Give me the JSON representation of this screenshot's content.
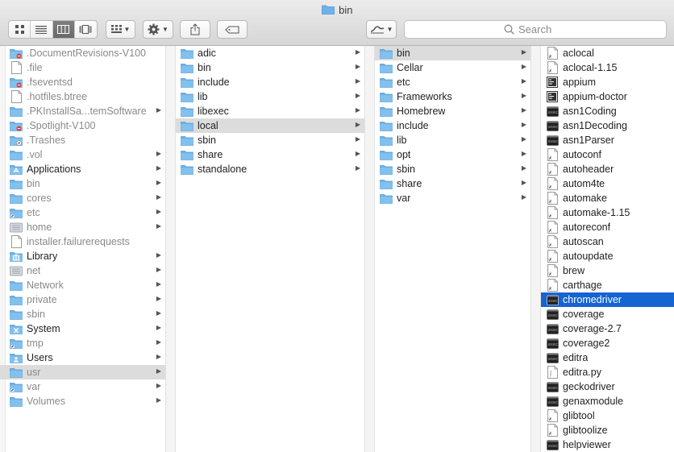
{
  "window": {
    "title": "bin"
  },
  "toolbar": {
    "view_modes": [
      "icon-view",
      "list-view",
      "column-view",
      "cover-flow-view"
    ],
    "active_view": "column-view",
    "search_placeholder": "Search"
  },
  "columns": [
    {
      "items": [
        {
          "label": ".DocumentRevisions-V100",
          "icon": "restricted-folder-icon",
          "dim": true,
          "arrow": false
        },
        {
          "label": ".file",
          "icon": "file-icon",
          "dim": true,
          "arrow": false
        },
        {
          "label": ".fseventsd",
          "icon": "restricted-folder-icon",
          "dim": true,
          "arrow": false
        },
        {
          "label": ".hotfiles.btree",
          "icon": "file-icon",
          "dim": true,
          "arrow": false
        },
        {
          "label": ".PKInstallSa...temSoftware",
          "icon": "folder-icon",
          "dim": true,
          "arrow": true
        },
        {
          "label": ".Spotlight-V100",
          "icon": "restricted-folder-icon",
          "dim": true,
          "arrow": false
        },
        {
          "label": ".Trashes",
          "icon": "trash-folder-icon",
          "dim": true,
          "arrow": false
        },
        {
          "label": ".vol",
          "icon": "folder-icon",
          "dim": true,
          "arrow": true
        },
        {
          "label": "Applications",
          "icon": "applications-folder-icon",
          "dim": false,
          "arrow": true
        },
        {
          "label": "bin",
          "icon": "folder-icon",
          "dim": true,
          "arrow": true
        },
        {
          "label": "cores",
          "icon": "folder-icon",
          "dim": true,
          "arrow": true
        },
        {
          "label": "etc",
          "icon": "alias-folder-icon",
          "dim": true,
          "arrow": true
        },
        {
          "label": "home",
          "icon": "network-folder-icon",
          "dim": true,
          "arrow": true
        },
        {
          "label": "installer.failurerequests",
          "icon": "file-icon",
          "dim": true,
          "arrow": false
        },
        {
          "label": "Library",
          "icon": "library-folder-icon",
          "dim": false,
          "arrow": true
        },
        {
          "label": "net",
          "icon": "network-folder-icon",
          "dim": true,
          "arrow": true
        },
        {
          "label": "Network",
          "icon": "folder-icon",
          "dim": true,
          "arrow": true
        },
        {
          "label": "private",
          "icon": "folder-icon",
          "dim": true,
          "arrow": true
        },
        {
          "label": "sbin",
          "icon": "folder-icon",
          "dim": true,
          "arrow": true
        },
        {
          "label": "System",
          "icon": "system-folder-icon",
          "dim": false,
          "arrow": true
        },
        {
          "label": "tmp",
          "icon": "alias-folder-icon",
          "dim": true,
          "arrow": true
        },
        {
          "label": "Users",
          "icon": "users-folder-icon",
          "dim": false,
          "arrow": true
        },
        {
          "label": "usr",
          "icon": "folder-icon",
          "dim": true,
          "arrow": true,
          "selected": "gray"
        },
        {
          "label": "var",
          "icon": "alias-folder-icon",
          "dim": true,
          "arrow": true
        },
        {
          "label": "Volumes",
          "icon": "folder-icon",
          "dim": true,
          "arrow": true
        }
      ]
    },
    {
      "items": [
        {
          "label": "adic",
          "icon": "folder-icon",
          "arrow": true
        },
        {
          "label": "bin",
          "icon": "folder-icon",
          "arrow": true
        },
        {
          "label": "include",
          "icon": "folder-icon",
          "arrow": true
        },
        {
          "label": "lib",
          "icon": "folder-icon",
          "arrow": true
        },
        {
          "label": "libexec",
          "icon": "folder-icon",
          "arrow": true
        },
        {
          "label": "local",
          "icon": "folder-icon",
          "arrow": true,
          "selected": "gray"
        },
        {
          "label": "sbin",
          "icon": "folder-icon",
          "arrow": true
        },
        {
          "label": "share",
          "icon": "folder-icon",
          "arrow": true
        },
        {
          "label": "standalone",
          "icon": "folder-icon",
          "arrow": true
        }
      ]
    },
    {
      "items": [
        {
          "label": "bin",
          "icon": "folder-icon",
          "arrow": true,
          "selected": "gray"
        },
        {
          "label": "Cellar",
          "icon": "folder-icon",
          "arrow": true
        },
        {
          "label": "etc",
          "icon": "folder-icon",
          "arrow": true
        },
        {
          "label": "Frameworks",
          "icon": "folder-icon",
          "arrow": true
        },
        {
          "label": "Homebrew",
          "icon": "folder-icon",
          "arrow": true
        },
        {
          "label": "include",
          "icon": "folder-icon",
          "arrow": true
        },
        {
          "label": "lib",
          "icon": "folder-icon",
          "arrow": true
        },
        {
          "label": "opt",
          "icon": "folder-icon",
          "arrow": true
        },
        {
          "label": "sbin",
          "icon": "folder-icon",
          "arrow": true
        },
        {
          "label": "share",
          "icon": "folder-icon",
          "arrow": true
        },
        {
          "label": "var",
          "icon": "folder-icon",
          "arrow": true
        }
      ]
    },
    {
      "items": [
        {
          "label": "aclocal",
          "icon": "script-file-icon"
        },
        {
          "label": "aclocal-1.15",
          "icon": "script-file-icon"
        },
        {
          "label": "appium",
          "icon": "exec-doc-icon"
        },
        {
          "label": "appium-doctor",
          "icon": "exec-doc-icon"
        },
        {
          "label": "asn1Coding",
          "icon": "terminal-exec-icon"
        },
        {
          "label": "asn1Decoding",
          "icon": "terminal-exec-icon"
        },
        {
          "label": "asn1Parser",
          "icon": "terminal-exec-icon"
        },
        {
          "label": "autoconf",
          "icon": "script-file-icon"
        },
        {
          "label": "autoheader",
          "icon": "script-file-icon"
        },
        {
          "label": "autom4te",
          "icon": "script-file-icon"
        },
        {
          "label": "automake",
          "icon": "script-file-icon"
        },
        {
          "label": "automake-1.15",
          "icon": "script-file-icon"
        },
        {
          "label": "autoreconf",
          "icon": "script-file-icon"
        },
        {
          "label": "autoscan",
          "icon": "script-file-icon"
        },
        {
          "label": "autoupdate",
          "icon": "script-file-icon"
        },
        {
          "label": "brew",
          "icon": "script-file-icon"
        },
        {
          "label": "carthage",
          "icon": "script-file-icon"
        },
        {
          "label": "chromedriver",
          "icon": "terminal-exec-icon",
          "selected": "blue"
        },
        {
          "label": "coverage",
          "icon": "terminal-exec-icon"
        },
        {
          "label": "coverage-2.7",
          "icon": "terminal-exec-icon"
        },
        {
          "label": "coverage2",
          "icon": "terminal-exec-icon"
        },
        {
          "label": "editra",
          "icon": "terminal-exec-icon"
        },
        {
          "label": "editra.py",
          "icon": "python-file-icon"
        },
        {
          "label": "geckodriver",
          "icon": "terminal-exec-icon"
        },
        {
          "label": "genaxmodule",
          "icon": "terminal-exec-icon"
        },
        {
          "label": "glibtool",
          "icon": "script-file-icon"
        },
        {
          "label": "glibtoolize",
          "icon": "script-file-icon"
        },
        {
          "label": "helpviewer",
          "icon": "terminal-exec-icon"
        }
      ]
    }
  ],
  "colors": {
    "folder": "#6db3e8",
    "selection_blue": "#1464d2",
    "selection_gray": "#dcdcdc"
  }
}
